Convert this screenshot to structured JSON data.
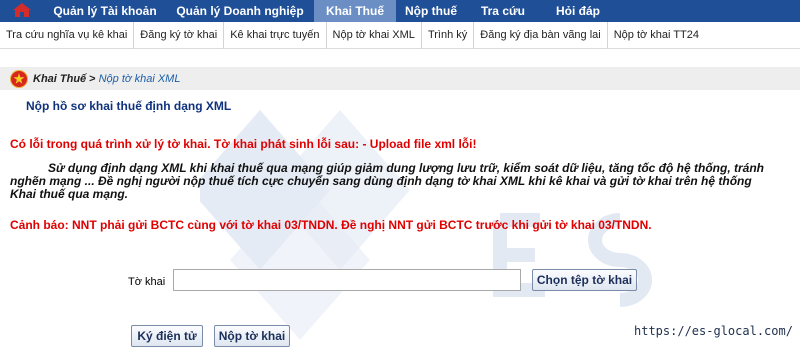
{
  "top_nav": {
    "items": [
      {
        "label": "Quản lý Tài khoản",
        "active": false
      },
      {
        "label": "Quản lý Doanh nghiệp",
        "active": false
      },
      {
        "label": "Khai Thuế",
        "active": true
      },
      {
        "label": "Nộp thuế",
        "active": false
      },
      {
        "label": "Tra cứu",
        "active": false
      },
      {
        "label": "Hỏi đáp",
        "active": false
      }
    ],
    "home_icon": "home-icon",
    "background": "#1f4f97",
    "active_background": "#6b8fc5"
  },
  "sub_nav": {
    "items": [
      "Tra cứu nghĩa vụ kê khai",
      "Đăng ký tờ khai",
      "Kê khai trực tuyến",
      "Nộp tờ khai XML",
      "Trình ký",
      "Đăng ký địa bàn vãng lai",
      "Nộp tờ khai TT24"
    ]
  },
  "breadcrumb": {
    "parent": "Khai Thuế",
    "separator": ">",
    "current": "Nộp tờ khai XML",
    "icon": "emblem-icon"
  },
  "main": {
    "title": "Nộp hồ sơ khai thuế định dạng XML",
    "error_message": "Có lỗi trong quá trình xử lý tờ khai. Tờ khai phát sinh lỗi sau: - Upload file xml lỗi!",
    "info_text": "Sử dụng định dạng XML khi khai thuế qua mạng giúp giảm dung lượng lưu trữ, kiểm soát dữ liệu, tăng tốc độ hệ thống, tránh nghẽn mạng ... Đề nghị người nộp thuế tích cực chuyển sang dùng định dạng tờ khai XML khi kê khai và gửi tờ khai trên hệ thống Khai thuế qua mạng.",
    "warning_message": "Cảnh báo: NNT phải gửi BCTC cùng với tờ khai 03/TNDN. Đề nghị NNT gửi BCTC trước khi gửi tờ khai 03/TNDN."
  },
  "form": {
    "file_label": "Tờ khai",
    "file_value": "",
    "choose_button": "Chọn tệp tờ khai",
    "sign_button": "Ký điện tử",
    "submit_button": "Nộp tờ khai"
  },
  "watermark_url": "https://es-glocal.com/",
  "colors": {
    "error": "#e00000",
    "title": "#10327d",
    "link": "#1b5ea8"
  }
}
